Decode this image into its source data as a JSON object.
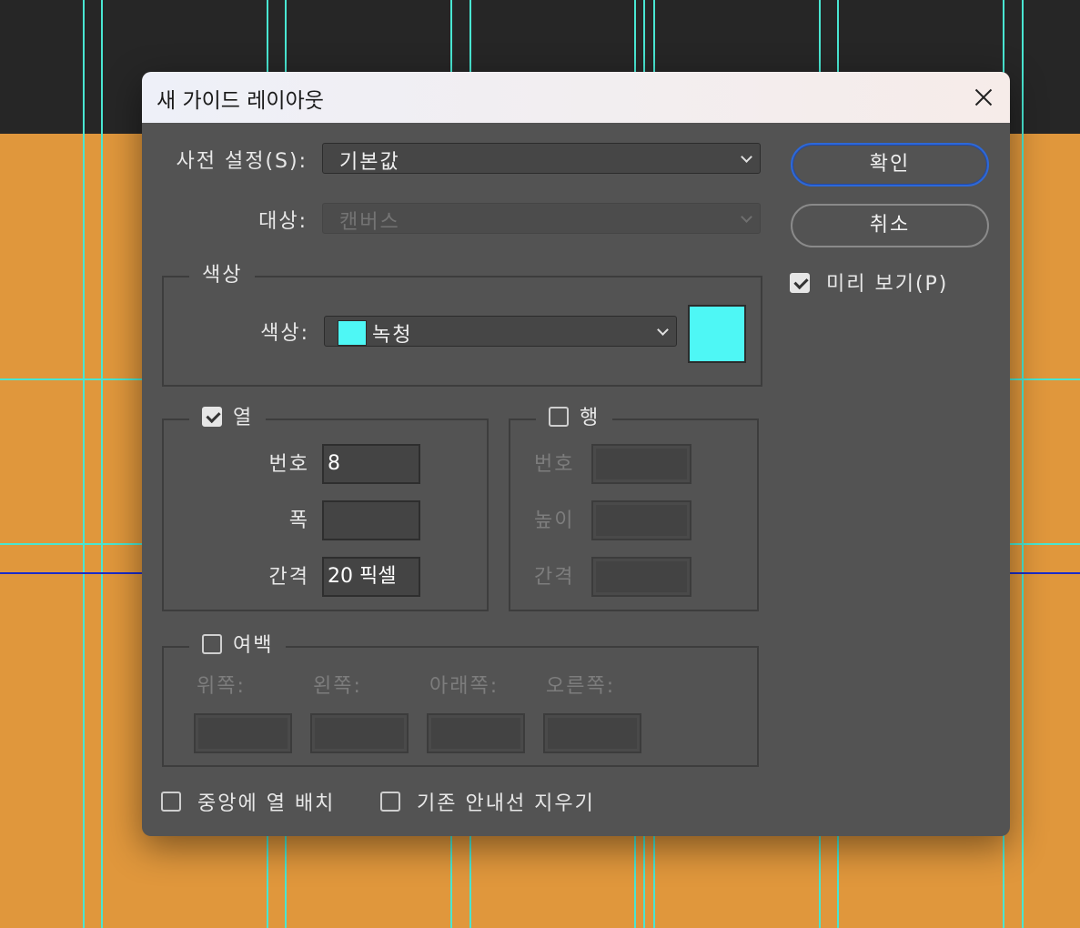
{
  "dialog": {
    "title": "새 가이드 레이아웃",
    "preset_label": "사전 설정(S):",
    "preset_value": "기본값",
    "target_label": "대상:",
    "target_value": "캔버스",
    "color_group_title": "색상",
    "color_label": "색상:",
    "color_value": "녹청",
    "color_hex": "#4ef7f5",
    "columns": {
      "title": "열",
      "checked": true,
      "number_label": "번호",
      "number_value": "8",
      "width_label": "폭",
      "width_value": "",
      "gutter_label": "간격",
      "gutter_value": "20 픽셀"
    },
    "rows": {
      "title": "행",
      "checked": false,
      "number_label": "번호",
      "height_label": "높이",
      "gutter_label": "간격"
    },
    "margin": {
      "title": "여백",
      "checked": false,
      "top_label": "위쪽:",
      "left_label": "왼쪽:",
      "bottom_label": "아래쪽:",
      "right_label": "오른쪽:"
    },
    "center_columns_label": "중앙에 열 배치",
    "clear_existing_label": "기존 안내선 지우기",
    "ok_label": "확인",
    "cancel_label": "취소",
    "preview_label": "미리 보기(P)",
    "preview_checked": true
  },
  "colors": {
    "guide": "#49e6d2",
    "canvas": "#e0973c",
    "primary_button_border": "#2d68d8"
  }
}
